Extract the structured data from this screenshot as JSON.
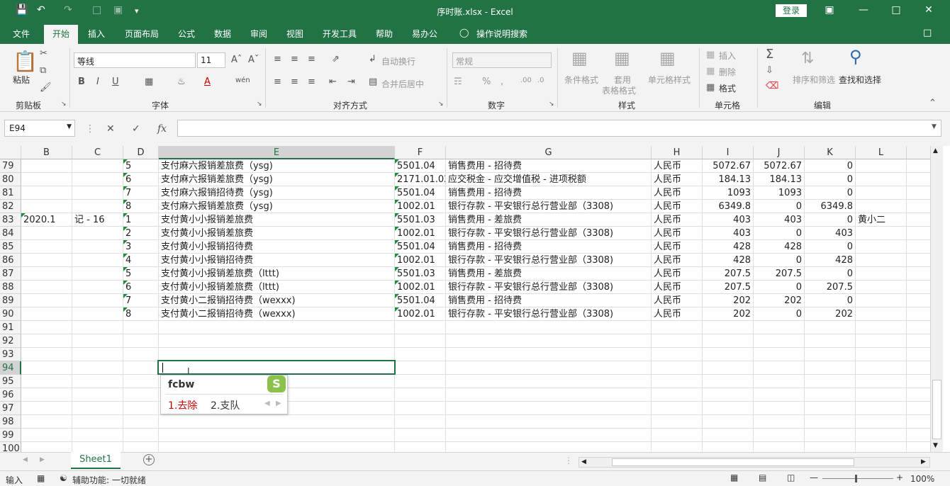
{
  "title_bar": {
    "title": "序时账.xlsx  -  Excel",
    "login_label": "登录",
    "save_icon": "save-icon",
    "undo_icon": "undo-icon",
    "redo_icon": "redo-icon"
  },
  "tabs": [
    {
      "label": "文件"
    },
    {
      "label": "开始"
    },
    {
      "label": "插入"
    },
    {
      "label": "页面布局"
    },
    {
      "label": "公式"
    },
    {
      "label": "数据"
    },
    {
      "label": "审阅"
    },
    {
      "label": "视图"
    },
    {
      "label": "开发工具"
    },
    {
      "label": "帮助"
    },
    {
      "label": "易办公"
    },
    {
      "label": "操作说明搜索"
    }
  ],
  "ribbon": {
    "clipboard": {
      "paste_label": "粘贴",
      "group_label": "剪贴板"
    },
    "font": {
      "font_name": "等线",
      "font_size": "11",
      "group_label": "字体"
    },
    "alignment": {
      "wrap_label": "自动换行",
      "merge_label": "合并后居中",
      "group_label": "对齐方式"
    },
    "number": {
      "format_value": "常规",
      "group_label": "数字"
    },
    "styles": {
      "cond_format_label": "条件格式",
      "table_format_label_1": "套用",
      "table_format_label_2": "表格格式",
      "cell_style_label": "单元格样式",
      "group_label": "样式"
    },
    "cells": {
      "insert_label": "插入",
      "delete_label": "删除",
      "format_label": "格式",
      "group_label": "单元格"
    },
    "editing": {
      "sort_label": "排序和筛选",
      "find_label": "查找和选择",
      "group_label": "编辑"
    }
  },
  "formula_bar": {
    "name_box": "E94",
    "formula": ""
  },
  "columns": [
    "B",
    "C",
    "D",
    "E",
    "F",
    "G",
    "H",
    "I",
    "J",
    "K",
    "L"
  ],
  "rows": [
    {
      "num": "79",
      "B": "",
      "C": "",
      "D": "5",
      "E": "支付麻六报销差旅费（ysg)",
      "F": "5501.04",
      "G": "销售费用 - 招待费",
      "H": "人民币",
      "I": "5072.67",
      "J": "5072.67",
      "K": "0",
      "L": ""
    },
    {
      "num": "80",
      "B": "",
      "C": "",
      "D": "6",
      "E": "支付麻六报销差旅费（ysg)",
      "F": "2171.01.02",
      "G": "应交税金 - 应交增值税 - 进项税额",
      "H": "人民币",
      "I": "184.13",
      "J": "184.13",
      "K": "0",
      "L": ""
    },
    {
      "num": "81",
      "B": "",
      "C": "",
      "D": "7",
      "E": "支付麻六报销招待费（ysg)",
      "F": "5501.04",
      "G": "销售费用 - 招待费",
      "H": "人民币",
      "I": "1093",
      "J": "1093",
      "K": "0",
      "L": ""
    },
    {
      "num": "82",
      "B": "",
      "C": "",
      "D": "8",
      "E": "支付麻六报销差旅费（ysg)",
      "F": "1002.01",
      "G": "银行存款 - 平安银行总行营业部（3308)",
      "H": "人民币",
      "I": "6349.8",
      "J": "0",
      "K": "6349.8",
      "L": ""
    },
    {
      "num": "83",
      "B": "2020.1",
      "C": "记 - 16",
      "D": "1",
      "E": "支付黄小小报销差旅费",
      "F": "5501.03",
      "G": "销售费用 - 差旅费",
      "H": "人民币",
      "I": "403",
      "J": "403",
      "K": "0",
      "L": "黄小二"
    },
    {
      "num": "84",
      "B": "",
      "C": "",
      "D": "2",
      "E": "支付黄小小报销差旅费",
      "F": "1002.01",
      "G": "银行存款 - 平安银行总行营业部（3308)",
      "H": "人民币",
      "I": "403",
      "J": "0",
      "K": "403",
      "L": ""
    },
    {
      "num": "85",
      "B": "",
      "C": "",
      "D": "3",
      "E": "支付黄小小报销招待费",
      "F": "5501.04",
      "G": "销售费用 - 招待费",
      "H": "人民币",
      "I": "428",
      "J": "428",
      "K": "0",
      "L": ""
    },
    {
      "num": "86",
      "B": "",
      "C": "",
      "D": "4",
      "E": "支付黄小小报销招待费",
      "F": "1002.01",
      "G": "银行存款 - 平安银行总行营业部（3308)",
      "H": "人民币",
      "I": "428",
      "J": "0",
      "K": "428",
      "L": ""
    },
    {
      "num": "87",
      "B": "",
      "C": "",
      "D": "5",
      "E": "支付黄小小报销差旅费（lttt)",
      "F": "5501.03",
      "G": "销售费用 - 差旅费",
      "H": "人民币",
      "I": "207.5",
      "J": "207.5",
      "K": "0",
      "L": ""
    },
    {
      "num": "88",
      "B": "",
      "C": "",
      "D": "6",
      "E": "支付黄小小报销差旅费（lttt)",
      "F": "1002.01",
      "G": "银行存款 - 平安银行总行营业部（3308)",
      "H": "人民币",
      "I": "207.5",
      "J": "0",
      "K": "207.5",
      "L": ""
    },
    {
      "num": "89",
      "B": "",
      "C": "",
      "D": "7",
      "E": "支付黄小二报销招待费（wexxx)",
      "F": "5501.04",
      "G": "销售费用 - 招待费",
      "H": "人民币",
      "I": "202",
      "J": "202",
      "K": "0",
      "L": ""
    },
    {
      "num": "90",
      "B": "",
      "C": "",
      "D": "8",
      "E": "支付黄小二报销招待费（wexxx)",
      "F": "1002.01",
      "G": "银行存款 - 平安银行总行营业部（3308)",
      "H": "人民币",
      "I": "202",
      "J": "0",
      "K": "202",
      "L": ""
    },
    {
      "num": "91"
    },
    {
      "num": "92"
    },
    {
      "num": "93"
    },
    {
      "num": "94"
    },
    {
      "num": "95"
    },
    {
      "num": "96"
    },
    {
      "num": "97"
    },
    {
      "num": "98"
    },
    {
      "num": "99"
    },
    {
      "num": "100"
    }
  ],
  "ime": {
    "input": "fcbw",
    "candidate_1": "1.去除",
    "candidate_2": "2.支队"
  },
  "sheet": {
    "tab_label": "Sheet1"
  },
  "status": {
    "mode": "输入",
    "accessibility": "辅助功能: 一切就绪",
    "zoom": "100%"
  },
  "colors": {
    "brand": "#217346",
    "candidate_highlight": "#cc0000"
  }
}
